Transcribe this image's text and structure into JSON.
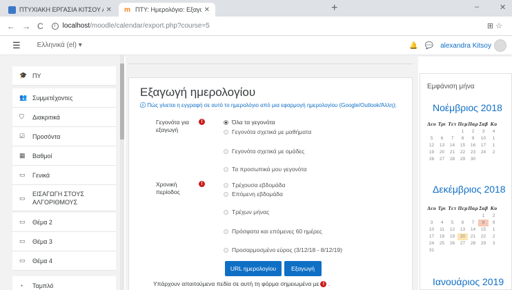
{
  "browser": {
    "tabs": [
      {
        "title": "ΠΤΥΧΙΑΚΗ ΕΡΓΑΣΙΑ ΚΙΤΣΟΥ ΑΛΕ",
        "active": false
      },
      {
        "title": "ΠΤΥ: Ημερολόγιο: Εξαγωγή",
        "active": true
      }
    ],
    "new_tab": "+",
    "url_host": "localhost",
    "url_path": "/moodle/calendar/export.php?course=5",
    "win_min": "–",
    "win_close": "✕"
  },
  "navbar": {
    "language": "Ελληνικά (el) ▾",
    "user_name": "alexandra Kitsoy"
  },
  "drawer": {
    "items": [
      {
        "label": "ΠΥ",
        "icon": "graduation-cap-icon",
        "glyph": "🎓"
      },
      {
        "label": "Συμμετέχοντες",
        "icon": "users-icon",
        "glyph": "👥"
      },
      {
        "label": "Διακριτικά",
        "icon": "shield-icon",
        "glyph": "⛉"
      },
      {
        "label": "Προσόντα",
        "icon": "checkbox-icon",
        "glyph": "☑"
      },
      {
        "label": "Βαθμοί",
        "icon": "table-icon",
        "glyph": "▦"
      },
      {
        "label": "Γενικά",
        "icon": "folder-icon",
        "glyph": "▭"
      },
      {
        "label": "ΕΙΣΑΓΩΓΗ ΣΤΟΥΣ ΑΛΓΟΡΙΘΜΟΥΣ",
        "icon": "folder-icon",
        "glyph": "▭"
      },
      {
        "label": "Θέμα 2",
        "icon": "folder-icon",
        "glyph": "▭"
      },
      {
        "label": "Θέμα 3",
        "icon": "folder-icon",
        "glyph": "▭"
      },
      {
        "label": "Θέμα 4",
        "icon": "folder-icon",
        "glyph": "▭"
      },
      {
        "label": "Ταμπλό",
        "icon": "dashboard-icon",
        "glyph": "◔"
      }
    ]
  },
  "main": {
    "title": "Εξαγωγή ημερολογίου",
    "help_text": "Πώς γίνεται η εγγραφή σε αυτό το ημερολόγιο από μια εφαρμογή ημερολογίου (Google/Outlook/Άλλη);",
    "events_label": "Γεγονότα για εξαγωγή",
    "events_options": [
      "Όλα τα γεγονότα",
      "Γεγονότα σχετικά με μαθήματα",
      "Γεγονότα σχετικά με ομάδες",
      "Τα προσωπικά μου γεγονότα"
    ],
    "events_selected": 0,
    "period_label": "Χρονική περίοδος",
    "period_options": [
      "Τρέχουσα εβδομάδα",
      "Επόμενη εβδομάδα",
      "Τρέχων μήνας",
      "Πρόσφατα και επόμενες 60 ημέρες",
      "Προσαρμοσμένο εύρος (3/12/18 - 8/12/19)"
    ],
    "url_button": "URL ημερολογίου",
    "export_button": "Εξαγωγή",
    "required_note": "Υπάρχουν απαιτούμενα πεδία σε αυτή τη φόρμα σημειωμένα με",
    "required_glyph": "!"
  },
  "calendar": {
    "block_title": "Εμφάνιση μήνα",
    "weekdays": [
      "Δευ",
      "Τρι",
      "Τετ",
      "Πεμ",
      "Παρ",
      "Σαβ",
      "Κυ"
    ],
    "months": [
      {
        "name": "Νοέμβριος 2018",
        "weeks": [
          [
            "",
            "",
            "",
            "1",
            "2",
            "3",
            "4"
          ],
          [
            "5",
            "6",
            "7",
            "8",
            "9",
            "10",
            "1"
          ],
          [
            "12",
            "13",
            "14",
            "15",
            "16",
            "17",
            "1"
          ],
          [
            "19",
            "20",
            "21",
            "22",
            "23",
            "24",
            "2"
          ],
          [
            "26",
            "27",
            "28",
            "29",
            "30",
            "",
            ""
          ]
        ]
      },
      {
        "name": "Δεκέμβριος 2018",
        "weeks": [
          [
            "",
            "",
            "",
            "",
            "",
            "1",
            "2"
          ],
          [
            "3",
            "4",
            "5",
            "6",
            "7",
            "8",
            "9"
          ],
          [
            "10",
            "11",
            "12",
            "13",
            "14",
            "15",
            "1"
          ],
          [
            "17",
            "18",
            "19",
            "20",
            "21",
            "22",
            "2"
          ],
          [
            "24",
            "25",
            "26",
            "27",
            "28",
            "29",
            "3"
          ],
          [
            "31",
            "",
            "",
            "",
            "",
            "",
            ""
          ]
        ],
        "highlight_today": "20",
        "highlight_event": "8"
      },
      {
        "name": "Ιανουάριος 2019",
        "weeks": []
      }
    ]
  },
  "colors": {
    "primary": "#0f6fc5",
    "required": "#c81d1d",
    "today": "#fce5b2",
    "event": "#f7c8b6"
  }
}
